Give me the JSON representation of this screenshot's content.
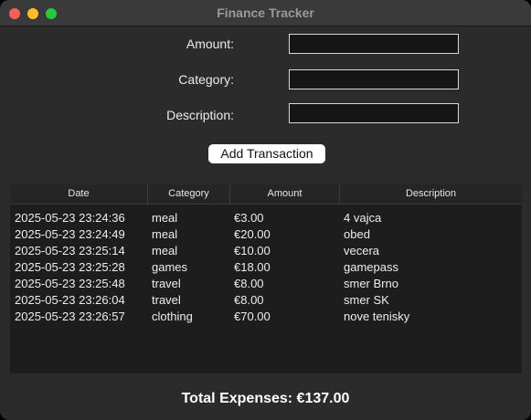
{
  "window": {
    "title": "Finance Tracker"
  },
  "form": {
    "amount_label": "Amount:",
    "amount_value": "",
    "category_label": "Category:",
    "category_value": "",
    "description_label": "Description:",
    "description_value": "",
    "add_button_label": "Add Transaction"
  },
  "table": {
    "columns": [
      "Date",
      "Category",
      "Amount",
      "Description"
    ],
    "rows": [
      {
        "date": "2025-05-23 23:24:36",
        "category": "meal",
        "amount": "€3.00",
        "description": "4 vajca"
      },
      {
        "date": "2025-05-23 23:24:49",
        "category": "meal",
        "amount": "€20.00",
        "description": "obed"
      },
      {
        "date": "2025-05-23 23:25:14",
        "category": "meal",
        "amount": "€10.00",
        "description": "vecera"
      },
      {
        "date": "2025-05-23 23:25:28",
        "category": "games",
        "amount": "€18.00",
        "description": "gamepass"
      },
      {
        "date": "2025-05-23 23:25:48",
        "category": "travel",
        "amount": "€8.00",
        "description": "smer Brno"
      },
      {
        "date": "2025-05-23 23:26:04",
        "category": "travel",
        "amount": "€8.00",
        "description": "smer SK"
      },
      {
        "date": "2025-05-23 23:26:57",
        "category": "clothing",
        "amount": "€70.00",
        "description": "nove tenisky"
      }
    ]
  },
  "total": {
    "label": "Total Expenses: €137.00"
  },
  "colors": {
    "window_bg": "#2b2b2b",
    "titlebar_bg": "#3a3a3a",
    "close": "#ff5f57",
    "minimize": "#febc2e",
    "maximize": "#28c840",
    "table_bg": "#1d1d1d"
  }
}
